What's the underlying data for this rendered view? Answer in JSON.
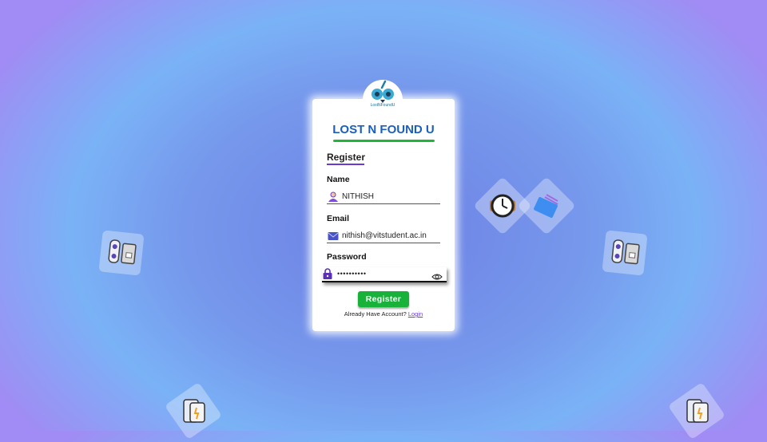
{
  "app": {
    "logo_caption": "LostNFoundU",
    "brand_title": "LOST N FOUND U"
  },
  "form": {
    "heading": "Register",
    "name_label": "Name",
    "name_value": "NITHISH",
    "email_label": "Email",
    "email_value": "nithish@vitstudent.ac.in",
    "password_label": "Password",
    "password_value": "••••••••••",
    "submit_label": "Register",
    "account_prompt": "Already Have Account?",
    "login_link": "Login"
  },
  "decor": {
    "icons": [
      "usb-drive-icon",
      "wristwatch-icon",
      "wallet-icon",
      "smartphone-icon"
    ]
  },
  "colors": {
    "brand_blue": "#1a5fc0",
    "accent_green": "#1fb53b",
    "accent_purple": "#6a3bd1",
    "button_green": "#18b23a"
  }
}
